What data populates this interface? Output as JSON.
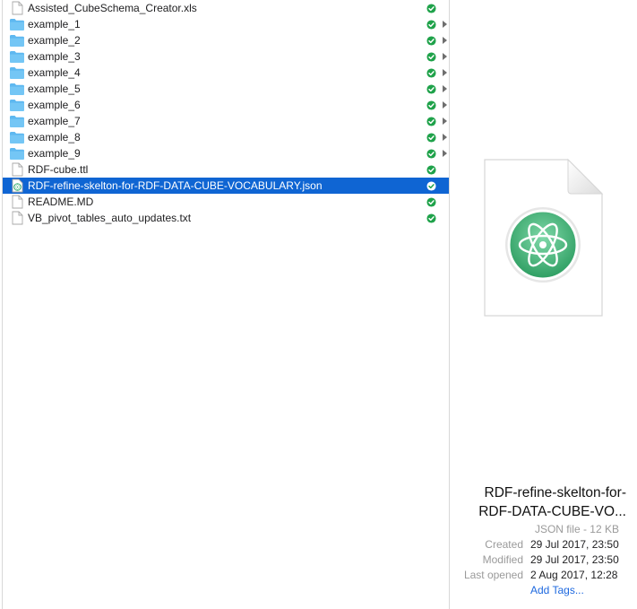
{
  "files": [
    {
      "name": "Assisted_CubeSchema_Creator.xls",
      "kind": "file",
      "synced": true,
      "expandable": false,
      "selected": false
    },
    {
      "name": "example_1",
      "kind": "folder",
      "synced": true,
      "expandable": true,
      "selected": false
    },
    {
      "name": "example_2",
      "kind": "folder",
      "synced": true,
      "expandable": true,
      "selected": false
    },
    {
      "name": "example_3",
      "kind": "folder",
      "synced": true,
      "expandable": true,
      "selected": false
    },
    {
      "name": "example_4",
      "kind": "folder",
      "synced": true,
      "expandable": true,
      "selected": false
    },
    {
      "name": "example_5",
      "kind": "folder",
      "synced": true,
      "expandable": true,
      "selected": false
    },
    {
      "name": "example_6",
      "kind": "folder",
      "synced": true,
      "expandable": true,
      "selected": false
    },
    {
      "name": "example_7",
      "kind": "folder",
      "synced": true,
      "expandable": true,
      "selected": false
    },
    {
      "name": "example_8",
      "kind": "folder",
      "synced": true,
      "expandable": true,
      "selected": false
    },
    {
      "name": "example_9",
      "kind": "folder",
      "synced": true,
      "expandable": true,
      "selected": false
    },
    {
      "name": "RDF-cube.ttl",
      "kind": "file",
      "synced": true,
      "expandable": false,
      "selected": false
    },
    {
      "name": "RDF-refine-skelton-for-RDF-DATA-CUBE-VOCABULARY.json",
      "kind": "atom-file",
      "synced": true,
      "expandable": false,
      "selected": true
    },
    {
      "name": "README.MD",
      "kind": "file",
      "synced": true,
      "expandable": false,
      "selected": false
    },
    {
      "name": "VB_pivot_tables_auto_updates.txt",
      "kind": "file",
      "synced": true,
      "expandable": false,
      "selected": false
    }
  ],
  "preview": {
    "name_line1": "RDF-refine-skelton-for-",
    "name_line2": "RDF-DATA-CUBE-VO...",
    "kind_size": "JSON file - 12 KB",
    "meta": [
      {
        "label": "Created",
        "value": "29 Jul 2017, 23:50"
      },
      {
        "label": "Modified",
        "value": "29 Jul 2017, 23:50"
      },
      {
        "label": "Last opened",
        "value": "2 Aug 2017, 12:28"
      }
    ],
    "add_tags": "Add Tags..."
  },
  "colors": {
    "selection": "#0f65d3",
    "sync_green": "#1fa24a",
    "folder_blue": "#5eb8f0",
    "atom_green": "#3cb075",
    "link_blue": "#1d68df"
  },
  "icons": {
    "folder": "folder-icon",
    "file": "document-icon",
    "atom_file": "atom-document-icon",
    "synced": "sync-check-icon",
    "expand": "chevron-right-icon"
  }
}
